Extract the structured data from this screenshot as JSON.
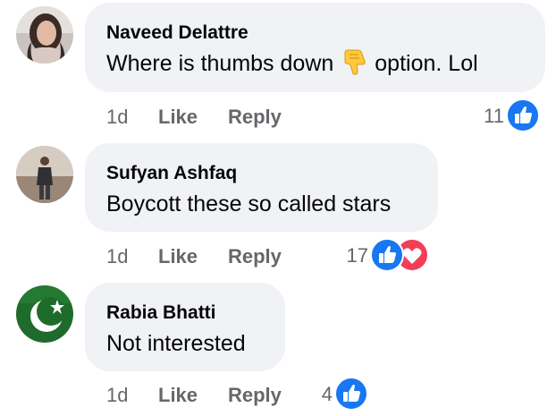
{
  "comments": [
    {
      "author": "Naveed Delattre",
      "text_before": "Where is thumbs down",
      "text_emoji": "thumbs-down-emoji",
      "text_after": "option. Lol",
      "time": "1d",
      "like_label": "Like",
      "reply_label": "Reply",
      "reaction_count": "11",
      "reactions": [
        "like"
      ]
    },
    {
      "author": "Sufyan Ashfaq",
      "text": "Boycott these so called stars",
      "time": "1d",
      "like_label": "Like",
      "reply_label": "Reply",
      "reaction_count": "17",
      "reactions": [
        "like",
        "love"
      ]
    },
    {
      "author": "Rabia Bhatti",
      "text": "Not interested",
      "time": "1d",
      "like_label": "Like",
      "reply_label": "Reply",
      "reaction_count": "4",
      "reactions": [
        "like"
      ]
    }
  ],
  "colors": {
    "bubble": "#f0f2f5",
    "meta_text": "#65676b",
    "like_blue": "#1877f2",
    "love_red": "#f33e58",
    "emoji_yellow": "#ffc83d",
    "flag_green": "#1f6b2c"
  }
}
